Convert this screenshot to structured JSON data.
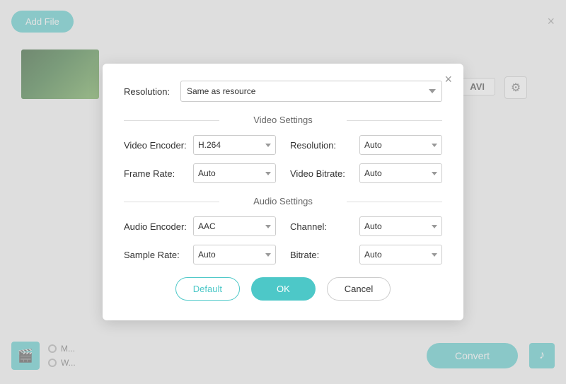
{
  "app": {
    "add_file_label": "Add File",
    "close_label": "×",
    "convert_label": "Convert",
    "avi_label": "AVI"
  },
  "bottom": {
    "radio1": "M...",
    "radio2": "W...",
    "music_icon": "♪",
    "film_icon": "🎬"
  },
  "dialog": {
    "close_label": "×",
    "resolution_label": "Resolution:",
    "resolution_value": "Same as resource",
    "video_settings_label": "Video Settings",
    "audio_settings_label": "Audio Settings",
    "video_encoder_label": "Video Encoder:",
    "video_encoder_value": "H.264",
    "resolution_sub_label": "Resolution:",
    "resolution_sub_value": "Auto",
    "frame_rate_label": "Frame Rate:",
    "frame_rate_value": "Auto",
    "video_bitrate_label": "Video Bitrate:",
    "video_bitrate_value": "Auto",
    "audio_encoder_label": "Audio Encoder:",
    "audio_encoder_value": "AAC",
    "channel_label": "Channel:",
    "channel_value": "Auto",
    "sample_rate_label": "Sample Rate:",
    "sample_rate_value": "Auto",
    "bitrate_label": "Bitrate:",
    "bitrate_value": "Auto",
    "default_btn": "Default",
    "ok_btn": "OK",
    "cancel_btn": "Cancel"
  }
}
